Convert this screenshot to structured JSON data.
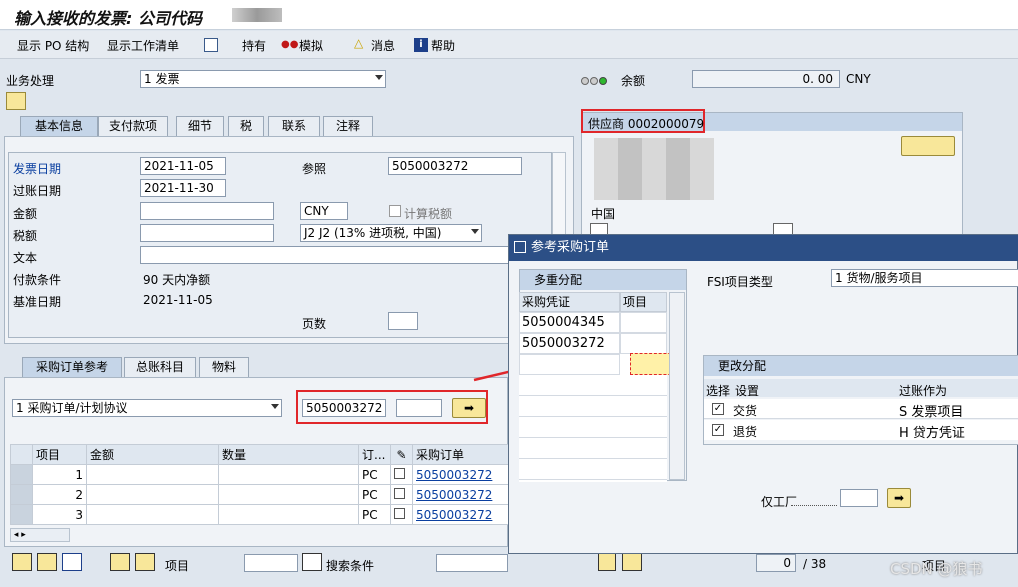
{
  "window": {
    "title": "输入接收的发票: 公司代码"
  },
  "toolbar": {
    "items": [
      "显示 PO 结构",
      "显示工作清单",
      "持有",
      "模拟",
      "消息",
      "帮助"
    ]
  },
  "header": {
    "biz_label": "业务处理",
    "biz_value": "1 发票",
    "balance_label": "余额",
    "balance_value": "0. 00",
    "currency": "CNY"
  },
  "tabs_top": [
    "基本信息",
    "支付款项",
    "细节",
    "税",
    "联系",
    "注释"
  ],
  "basic": {
    "invoice_date_label": "发票日期",
    "invoice_date": "2021-11-05",
    "reference_label": "参照",
    "reference": "5050003272",
    "posting_date_label": "过账日期",
    "posting_date": "2021-11-30",
    "amount_label": "金额",
    "amount_currency": "CNY",
    "calc_tax_label": "计算税额",
    "tax_label": "税额",
    "tax_code": "J2 J2 (13% 进项税, 中国)",
    "text_label": "文本",
    "payment_terms_label": "付款条件",
    "payment_terms": "90 天内净额",
    "baseline_label": "基准日期",
    "baseline_date": "2021-11-05",
    "pages_label": "页数"
  },
  "vendor": {
    "label": "供应商 0002000079",
    "country": "中国"
  },
  "tabs_bottom": [
    "采购订单参考",
    "总账科目",
    "物料"
  ],
  "po_ref": {
    "type": "1 采购订单/计划协议",
    "po_number": "5050003272"
  },
  "items_table": {
    "headers": [
      "项目",
      "金额",
      "数量",
      "订...",
      "",
      "采购订单"
    ],
    "rows": [
      {
        "item": "1",
        "unit": "PC",
        "po": "5050003272"
      },
      {
        "item": "2",
        "unit": "PC",
        "po": "5050003272"
      },
      {
        "item": "3",
        "unit": "PC",
        "po": "5050003272"
      }
    ]
  },
  "bottom_bar": {
    "item_label": "项目",
    "search_label": "搜索条件",
    "page_count": "0",
    "page_total": "/ 38",
    "item_label2": "项目"
  },
  "dialog": {
    "title": "参考采购订单",
    "multi_label": "多重分配",
    "col_po": "采购凭证",
    "col_item": "项目",
    "rows": [
      "5050004345",
      "5050003272"
    ],
    "fsi_label": "FSI项目类型",
    "fsi_value": "1 货物/服务项目",
    "change_label": "更改分配",
    "sel_header": "选择",
    "set_header": "设置",
    "post_header": "过账作为",
    "settings": [
      {
        "name": "交货",
        "post": "S 发票项目"
      },
      {
        "name": "退货",
        "post": "H 贷方凭证"
      }
    ],
    "plant_label": "仅工厂"
  },
  "watermark": "CSDN @狼书",
  "colors": {
    "red_highlight": "#e0262a",
    "dialog_title": "#2c4f86",
    "link": "#0a3fa0"
  }
}
